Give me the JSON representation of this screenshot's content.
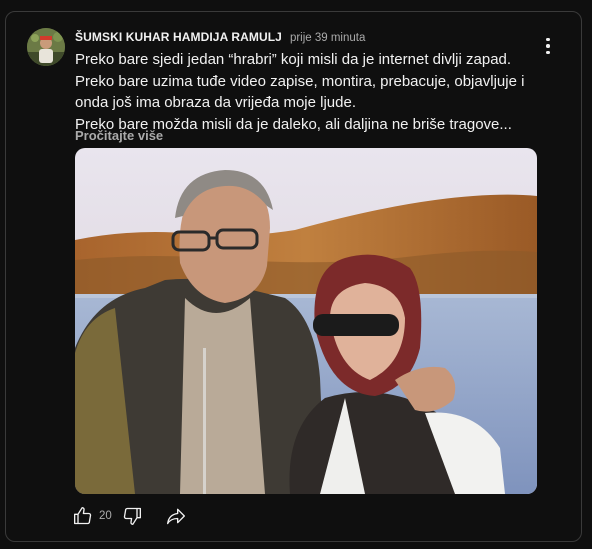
{
  "post": {
    "author": "ŠUMSKI KUHAR HAMDIJA RAMULJ",
    "time": "prije 39 minuta",
    "lines": [
      "Preko bare sjedi jedan “hrabri” koji misli da je internet divlji zapad.",
      "Preko bare uzima tuđe video zapise, montira, prebacuje, objavljuje i",
      "onda još ima obraza da vrijeđa moje ljude.",
      "Preko bare možda misli da je daleko, ali daljina ne briše tragove..."
    ],
    "read_more": "Pročitajte više",
    "like_count": "20"
  },
  "icons": {
    "menu": "more-vert-icon",
    "like": "thumb-up-icon",
    "dislike": "thumb-down-icon",
    "share": "share-icon"
  },
  "colors": {
    "background": "#0f0f0f",
    "text": "#f1f1f1",
    "secondary_text": "#aaaaaa",
    "border": "#3a3a3a"
  }
}
